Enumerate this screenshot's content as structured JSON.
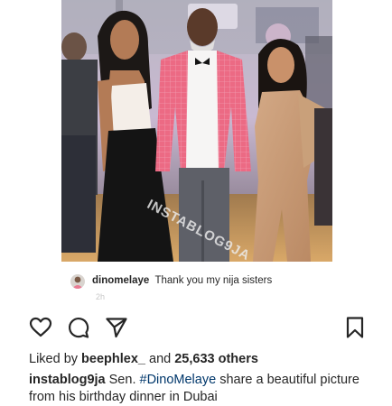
{
  "photo": {
    "alt": "Three people posing at an event",
    "watermark": "INSTABLOG9JA"
  },
  "comment": {
    "username": "dinomelaye",
    "text": "Thank you my nija sisters",
    "time": "2h"
  },
  "actions": {
    "like_icon": "heart-icon",
    "comment_icon": "comment-icon",
    "share_icon": "share-icon",
    "save_icon": "bookmark-icon"
  },
  "likes": {
    "prefix": "Liked by",
    "user": "beephlex_",
    "conjunction": "and",
    "count": "25,633 others"
  },
  "caption": {
    "username": "instablog9ja",
    "pre": "Sen.",
    "hashtag": "#DinoMelaye",
    "rest": "share a beautiful picture from his birthday dinner in Dubai"
  },
  "colors": {
    "text": "#262626",
    "hashtag": "#00376b",
    "jacket": "#e8607a"
  }
}
